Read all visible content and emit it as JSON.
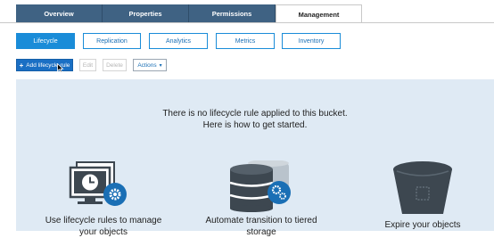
{
  "main_tabs": [
    "Overview",
    "Properties",
    "Permissions",
    "Management"
  ],
  "sub_tabs": [
    "Lifecycle",
    "Replication",
    "Analytics",
    "Metrics",
    "Inventory"
  ],
  "toolbar": {
    "add_label": "Add lifecycle rule",
    "edit_label": "Edit",
    "delete_label": "Delete",
    "actions_label": "Actions"
  },
  "empty_state": {
    "line1": "There is no lifecycle rule applied to this bucket.",
    "line2": "Here is how to get started."
  },
  "features": [
    {
      "icon": "computer-clock-gear-icon",
      "text1": "Use lifecycle rules to manage",
      "text2": "your objects"
    },
    {
      "icon": "database-gear-icon",
      "text1": "Automate transition to tiered",
      "text2": "storage"
    },
    {
      "icon": "trash-bucket-icon",
      "text1": "Expire your objects",
      "text2": ""
    }
  ],
  "colors": {
    "tab_bar": "#3f6283",
    "accent": "#1a8cd8",
    "primary_button": "#1a6fc4",
    "panel": "#dfeaf4",
    "icon_dark": "#3d4750"
  }
}
